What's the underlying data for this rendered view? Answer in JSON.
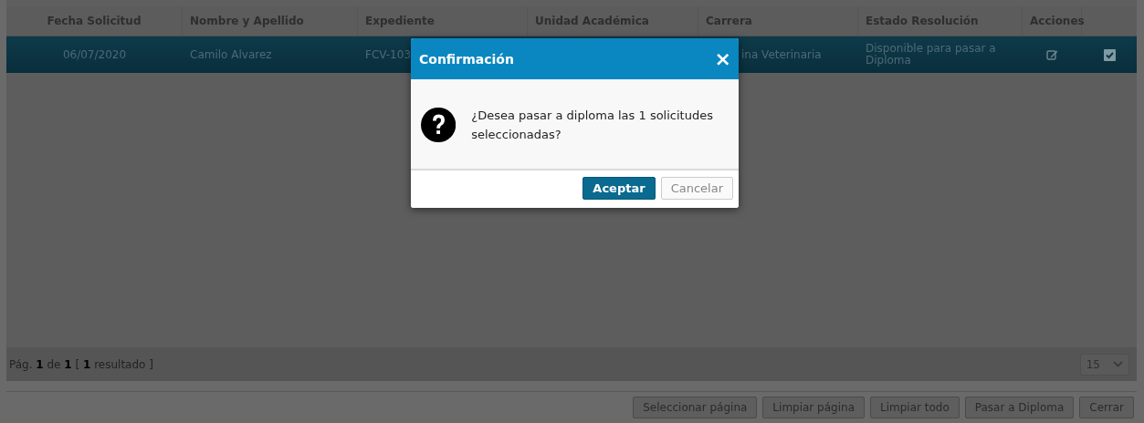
{
  "table": {
    "columns": [
      "Fecha Solicitud",
      "Nombre y Apellido",
      "Expediente",
      "Unidad Académica",
      "Carrera",
      "Estado Resolución",
      "Acciones"
    ],
    "rows": [
      {
        "selected": true,
        "checked": true,
        "cells": [
          "06/07/2020",
          "Camilo Alvarez",
          "FCV-103",
          "",
          "ina Veterinaria",
          "Disponible para pasar a Diploma"
        ]
      }
    ]
  },
  "pager": {
    "pag": "Pág.",
    "page": "1",
    "de": "de",
    "total": "1",
    "open": "[",
    "count": "1",
    "label": "resultado ]",
    "page_size": "15"
  },
  "buttons": [
    "Seleccionar página",
    "Limpiar página",
    "Limpiar todo",
    "Pasar a Diploma",
    "Cerrar"
  ],
  "dialog": {
    "title": "Confirmación",
    "close": "×",
    "message": "¿Desea pasar a diploma las 1 solicitudes seleccionadas?",
    "buttons": [
      {
        "label": "Aceptar",
        "kind": "primary"
      },
      {
        "label": "Cancelar",
        "kind": "secondary"
      }
    ]
  }
}
